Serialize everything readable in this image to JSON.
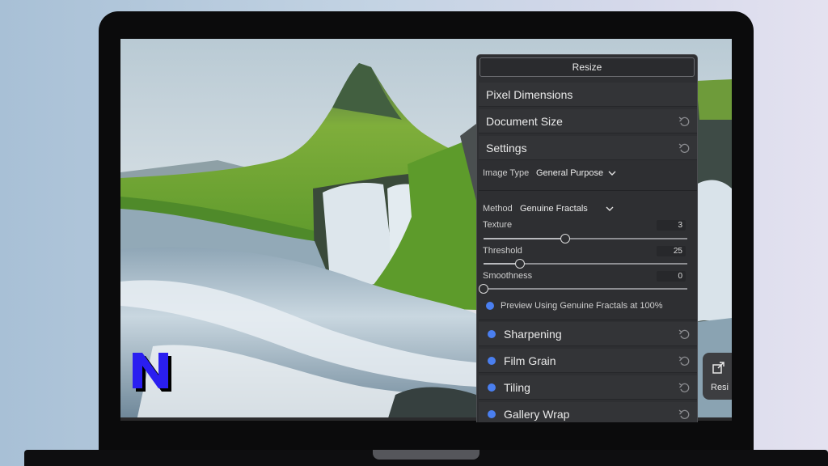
{
  "panel": {
    "header_label": "Resize",
    "sections": {
      "pixel_dimensions": "Pixel Dimensions",
      "document_size": "Document Size",
      "settings": "Settings"
    },
    "settings": {
      "image_type_label": "Image Type",
      "image_type_value": "General Purpose",
      "method_label": "Method",
      "method_value": "Genuine Fractals",
      "sliders": {
        "texture": {
          "label": "Texture",
          "value": "3",
          "level_percent": 40
        },
        "threshold": {
          "label": "Threshold",
          "value": "25",
          "level_percent": 18
        },
        "smoothness": {
          "label": "Smoothness",
          "value": "0",
          "level_percent": 0
        }
      },
      "preview_label": "Preview Using Genuine Fractals at 100%"
    },
    "extra_sections": {
      "sharpening": "Sharpening",
      "film_grain": "Film Grain",
      "tiling": "Tiling",
      "gallery_wrap": "Gallery Wrap"
    }
  },
  "side_tab": {
    "label": "Resi",
    "icon": "resize-icon"
  },
  "colors": {
    "accent_dot": "#4a7ff0",
    "panel_bg": "#2e2f32",
    "logo": "#2a1ef0"
  },
  "icons": {
    "reset": "undo-arrow-icon",
    "chevron": "chevron-down-icon",
    "logo": "n-logo-icon"
  }
}
